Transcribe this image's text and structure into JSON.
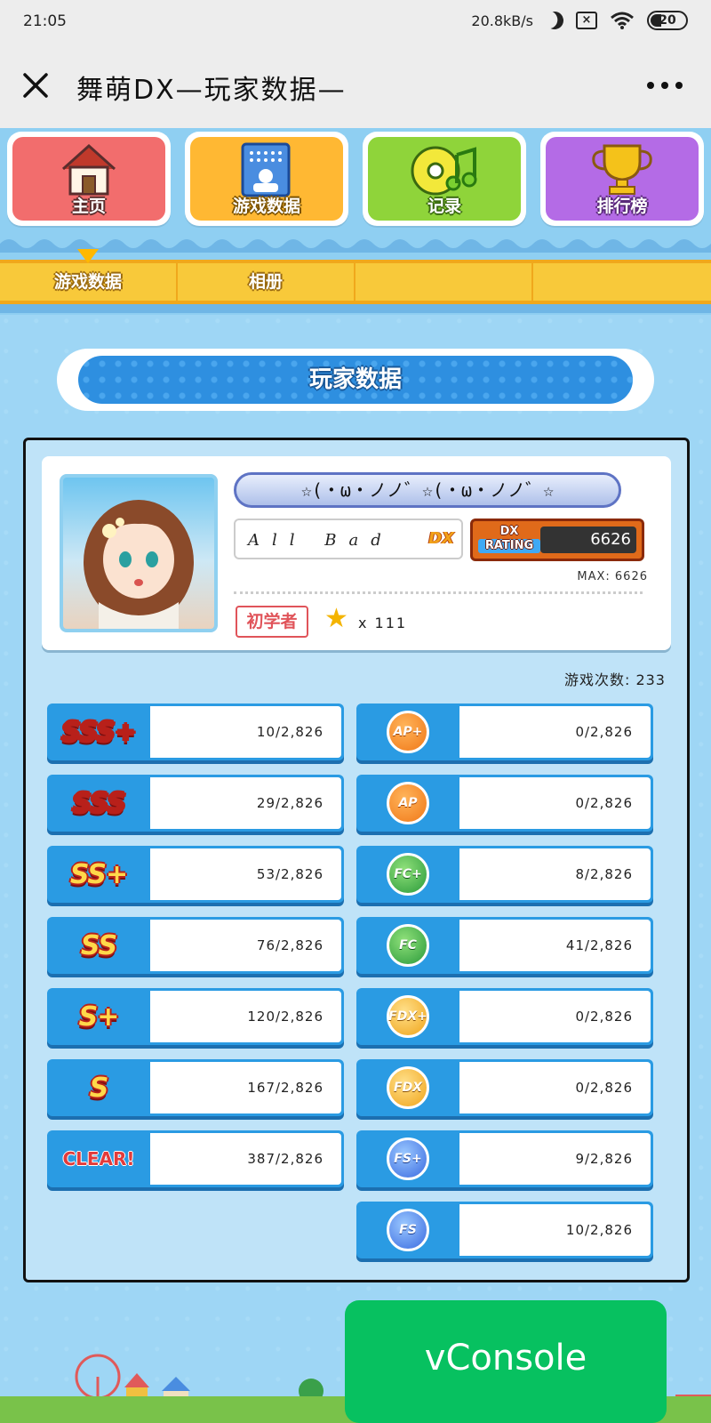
{
  "status_bar": {
    "time": "21:05",
    "net_speed": "20.8kB/s",
    "battery": "20"
  },
  "title_bar": {
    "title": "舞萌DX—玩家数据—"
  },
  "nav_tiles": [
    {
      "label": "主页",
      "icon": "house-icon"
    },
    {
      "label": "游戏数据",
      "icon": "phone-card-icon"
    },
    {
      "label": "记录",
      "icon": "cd-music-icon"
    },
    {
      "label": "排行榜",
      "icon": "trophy-icon"
    }
  ],
  "sub_tabs": [
    "游戏数据",
    "相册",
    "",
    ""
  ],
  "banner": {
    "title": "玩家数据"
  },
  "profile": {
    "name": "☆(・ω・ノノ゛☆(・ω・ノノ゛☆",
    "player_title": "All Bad",
    "dx_mark": "DX",
    "rating_label_1": "DX",
    "rating_label_2": "RATING",
    "rating": "6626",
    "rating_max": "MAX: 6626",
    "level": "初学者",
    "stars": "x 111"
  },
  "play_count": "游戏次数: 233",
  "ranks": [
    {
      "rank": "SSS+",
      "value": "10/2,826"
    },
    {
      "rank": "SSS",
      "value": "29/2,826"
    },
    {
      "rank": "SS+",
      "value": "53/2,826"
    },
    {
      "rank": "SS",
      "value": "76/2,826"
    },
    {
      "rank": "S+",
      "value": "120/2,826"
    },
    {
      "rank": "S",
      "value": "167/2,826"
    },
    {
      "rank": "CLEAR!",
      "value": "387/2,826"
    }
  ],
  "medals": [
    {
      "medal": "AP+",
      "value": "0/2,826",
      "color": "#f07818"
    },
    {
      "medal": "AP",
      "value": "0/2,826",
      "color": "#f07818"
    },
    {
      "medal": "FC+",
      "value": "8/2,826",
      "color": "#2a9a3a"
    },
    {
      "medal": "FC",
      "value": "41/2,826",
      "color": "#2a9a3a"
    },
    {
      "medal": "FDX+",
      "value": "0/2,826",
      "color": "#f0a41a"
    },
    {
      "medal": "FDX",
      "value": "0/2,826",
      "color": "#f0a41a"
    },
    {
      "medal": "FS+",
      "value": "9/2,826",
      "color": "#3a6ae0"
    },
    {
      "medal": "FS",
      "value": "10/2,826",
      "color": "#3a6ae0"
    }
  ],
  "vconsole": {
    "label": "vConsole"
  }
}
